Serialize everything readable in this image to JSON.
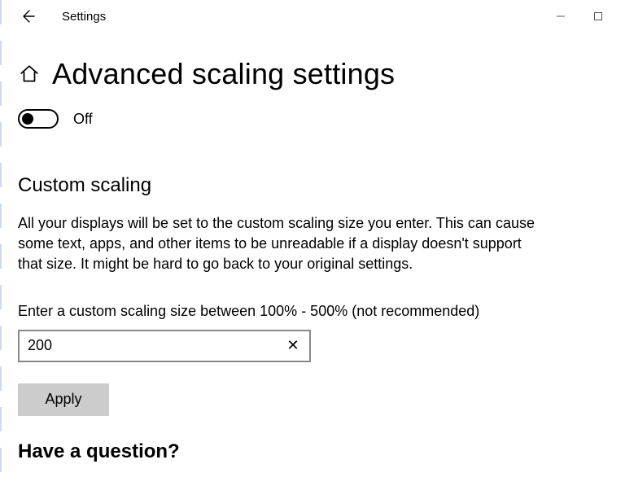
{
  "titlebar": {
    "title": "Settings"
  },
  "page": {
    "title": "Advanced scaling settings"
  },
  "toggle": {
    "state_label": "Off"
  },
  "custom_scaling": {
    "heading": "Custom scaling",
    "description": "All your displays will be set to the custom scaling size you enter. This can cause some text, apps, and other items to be unreadable if a display doesn't support that size. It might be hard to go back to your original settings.",
    "field_label": "Enter a custom scaling size between 100% - 500% (not recommended)",
    "value": "200",
    "apply_label": "Apply"
  },
  "help": {
    "heading": "Have a question?"
  }
}
